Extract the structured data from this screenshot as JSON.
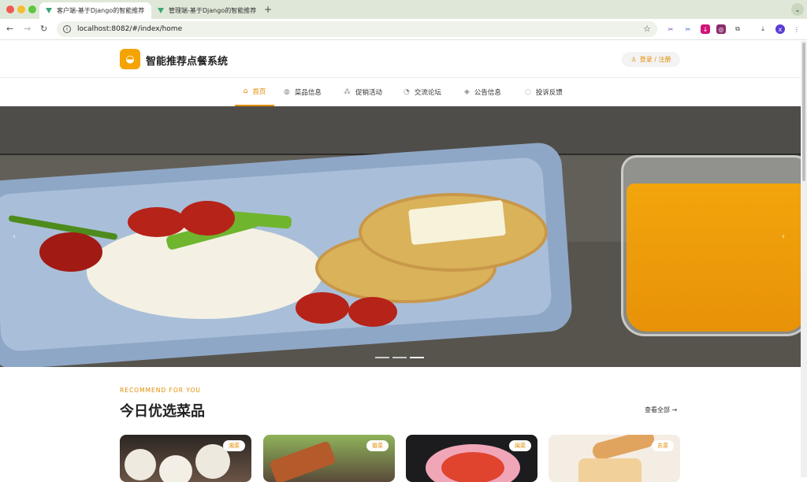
{
  "browser": {
    "tabs": [
      {
        "title": "客户端-基于Django的智能推荐",
        "active": true
      },
      {
        "title": "管理端-基于Django的智能推荐",
        "active": false
      }
    ],
    "url": "localhost:8082/#/index/home",
    "profile_initial": "x"
  },
  "header": {
    "site_title": "智能推荐点餐系统",
    "login_label": "登录 / 注册"
  },
  "nav": {
    "items": [
      {
        "label": "首页",
        "icon": "home-icon",
        "active": true
      },
      {
        "label": "菜品信息",
        "icon": "dish-icon",
        "active": false
      },
      {
        "label": "促销活动",
        "icon": "promo-icon",
        "active": false
      },
      {
        "label": "交流论坛",
        "icon": "forum-icon",
        "active": false
      },
      {
        "label": "公告信息",
        "icon": "notice-icon",
        "active": false
      },
      {
        "label": "投诉反馈",
        "icon": "feedback-icon",
        "active": false
      }
    ]
  },
  "carousel": {
    "slide_count": 3,
    "active_index": 2
  },
  "recommend": {
    "subtitle": "RECOMMEND FOR YOU",
    "title": "今日优选菜品",
    "view_all": "查看全部 →",
    "cards": [
      {
        "badge": "湘菜"
      },
      {
        "badge": "徽菜"
      },
      {
        "badge": "闽菜"
      },
      {
        "badge": "苏菜"
      }
    ]
  },
  "colors": {
    "accent": "#e38b00",
    "logo_bg": "#f5a300"
  }
}
